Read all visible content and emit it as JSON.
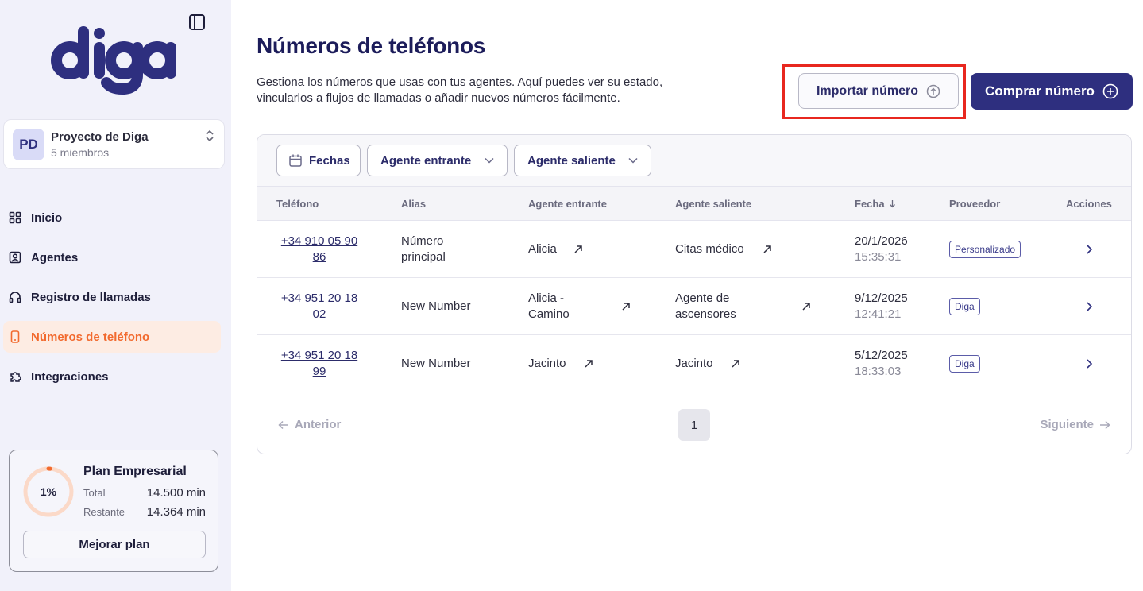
{
  "brand": {
    "logo_text": "diga",
    "accent": "#2e2f7f",
    "active": "#f26a2e"
  },
  "project": {
    "initials": "PD",
    "name": "Proyecto de Diga",
    "members": "5 miembros"
  },
  "nav": [
    {
      "label": "Inicio",
      "icon": "grid-icon",
      "active": false
    },
    {
      "label": "Agentes",
      "icon": "user-square-icon",
      "active": false
    },
    {
      "label": "Registro de llamadas",
      "icon": "headphones-icon",
      "active": false
    },
    {
      "label": "Números de teléfono",
      "icon": "phone-device-icon",
      "active": true
    },
    {
      "label": "Integraciones",
      "icon": "puzzle-icon",
      "active": false
    }
  ],
  "plan": {
    "percent_label": "1%",
    "used_fraction": 0.01,
    "title": "Plan Empresarial",
    "total_label": "Total",
    "total_value": "14.500 min",
    "remaining_label": "Restante",
    "remaining_value": "14.364 min",
    "upgrade_label": "Mejorar plan"
  },
  "page": {
    "title": "Números de teléfonos",
    "description": "Gestiona los números que usas con tus agentes. Aquí puedes ver su estado, vincularlos a flujos de llamadas o añadir nuevos números fácilmente.",
    "import_label": "Importar número",
    "buy_label": "Comprar número"
  },
  "filters": {
    "dates": "Fechas",
    "incoming": "Agente entrante",
    "outgoing": "Agente saliente"
  },
  "table": {
    "headers": {
      "phone": "Teléfono",
      "alias": "Alias",
      "incoming": "Agente entrante",
      "outgoing": "Agente saliente",
      "date": "Fecha",
      "provider": "Proveedor",
      "actions": "Acciones"
    },
    "rows": [
      {
        "phone_l1": "+34 910 05 90",
        "phone_l2": "86",
        "alias_l1": "Número",
        "alias_l2": "principal",
        "in_l1": "Alicia",
        "in_l2": "",
        "out_l1": "Citas médico",
        "out_l2": "",
        "date": "20/1/2026",
        "time": "15:35:31",
        "provider": "Personalizado"
      },
      {
        "phone_l1": "+34 951 20 18",
        "phone_l2": "02",
        "alias_l1": "New Number",
        "alias_l2": "",
        "in_l1": "Alicia -",
        "in_l2": "Camino",
        "out_l1": "Agente de",
        "out_l2": "ascensores",
        "date": "9/12/2025",
        "time": "12:41:21",
        "provider": "Diga"
      },
      {
        "phone_l1": "+34 951 20 18",
        "phone_l2": "99",
        "alias_l1": "New Number",
        "alias_l2": "",
        "in_l1": "Jacinto",
        "in_l2": "",
        "out_l1": "Jacinto",
        "out_l2": "",
        "date": "5/12/2025",
        "time": "18:33:03",
        "provider": "Diga"
      }
    ]
  },
  "pager": {
    "prev": "Anterior",
    "page": "1",
    "next": "Siguiente"
  }
}
